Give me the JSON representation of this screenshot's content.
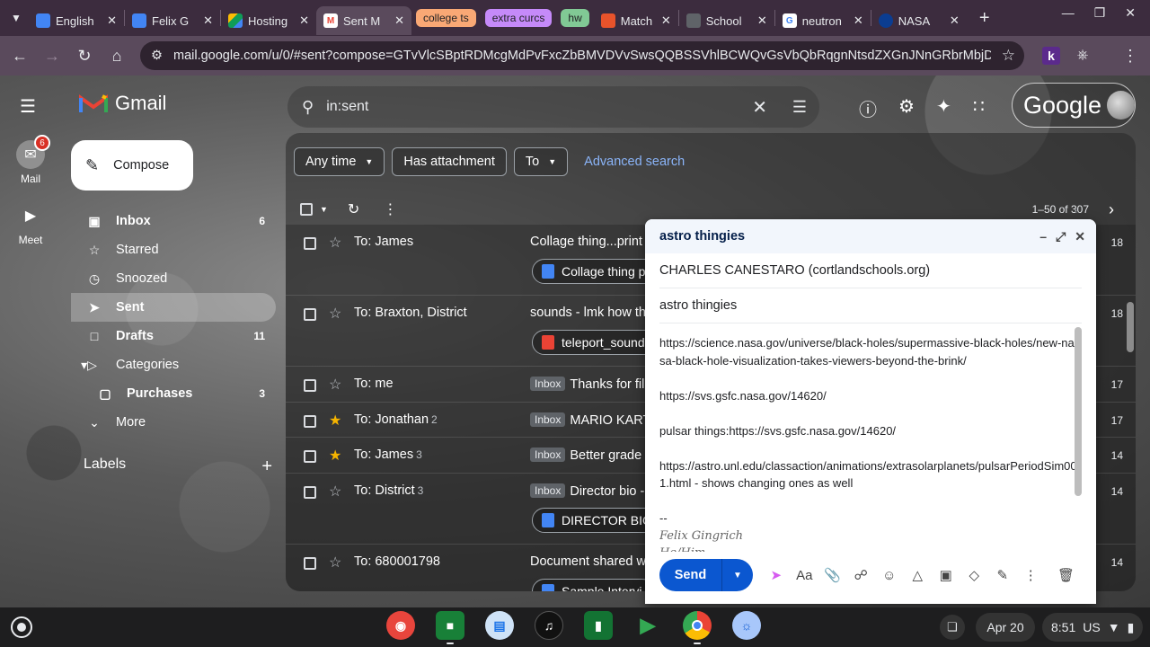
{
  "browser": {
    "tabs": [
      {
        "title": "English",
        "favicon_color": "#4285f4",
        "favicon": "classroom-icon"
      },
      {
        "title": "Felix G",
        "favicon_color": "#4285f4",
        "favicon": "docs-icon"
      },
      {
        "title": "Hosting",
        "favicon_color": "#0f9d58",
        "favicon": "drive-icon"
      },
      {
        "title": "Sent M",
        "favicon_color": "#ea4335",
        "favicon": "gmail-icon",
        "active": true
      }
    ],
    "groups": [
      {
        "label": "college ts",
        "color": "#f9a875"
      },
      {
        "label": "extra curcs",
        "color": "#c58af9"
      },
      {
        "label": "hw",
        "color": "#81c995"
      }
    ],
    "tabs2": [
      {
        "title": "Match",
        "favicon": "flame-icon"
      },
      {
        "title": "School",
        "favicon": "school-icon"
      },
      {
        "title": "neutron",
        "favicon": "google-icon"
      },
      {
        "title": "NASA",
        "favicon": "nasa-icon"
      }
    ],
    "url": "mail.google.com/u/0/#sent?compose=GTvVlcSBptRDMcgMdPvFxcZbBMVDVvSwsQQBSSVhlBCWQvGsVbQbRqgnNtsdZXGnJNnGRbrMbjDGW",
    "profile_letter": "k"
  },
  "gmail": {
    "logo_text": "Gmail",
    "search_query": "in:sent",
    "account_brand": "Google",
    "rail": [
      {
        "label": "Mail",
        "badge": "6"
      },
      {
        "label": "Meet"
      }
    ],
    "compose_label": "Compose",
    "nav": [
      {
        "label": "Inbox",
        "count": "6"
      },
      {
        "label": "Starred",
        "count": ""
      },
      {
        "label": "Snoozed",
        "count": ""
      },
      {
        "label": "Sent",
        "count": ""
      },
      {
        "label": "Drafts",
        "count": "11"
      },
      {
        "label": "Categories",
        "count": ""
      },
      {
        "label": "Purchases",
        "count": "3"
      },
      {
        "label": "More",
        "count": ""
      }
    ],
    "labels_heading": "Labels",
    "filters": {
      "any_time": "Any time",
      "has_attachment": "Has attachment",
      "to": "To",
      "advanced": "Advanced search"
    },
    "pager": "1–50 of 307",
    "rows": [
      {
        "to": "To: James",
        "n": "",
        "starred": false,
        "inbox": false,
        "subject": "Collage thing...print",
        "attachment": "Collage thing p",
        "att_color": "#4285f4",
        "date": "18"
      },
      {
        "to": "To: Braxton, District",
        "n": "",
        "starred": false,
        "inbox": false,
        "subject": "sounds - lmk how th",
        "attachment": "teleport_sound",
        "att_color": "#ea4335",
        "date": "18"
      },
      {
        "to": "To: me",
        "n": "",
        "starred": false,
        "inbox": true,
        "subject": "Thanks for fill",
        "attachment": "",
        "date": "17"
      },
      {
        "to": "To: Jonathan",
        "n": "2",
        "starred": true,
        "inbox": true,
        "subject": "MARIO KART",
        "attachment": "",
        "date": "17"
      },
      {
        "to": "To: James",
        "n": "3",
        "starred": true,
        "inbox": true,
        "subject": "Better grade",
        "attachment": "",
        "date": "14"
      },
      {
        "to": "To: District",
        "n": "3",
        "starred": false,
        "inbox": true,
        "subject": "Director bio -",
        "attachment": "DIRECTOR BIO",
        "att_color": "#4285f4",
        "date": "14"
      },
      {
        "to": "To: 680001798",
        "n": "",
        "starred": false,
        "inbox": false,
        "subject": "Document shared wi",
        "attachment": "Sample Intervi",
        "att_color": "#4285f4",
        "date": "14"
      }
    ],
    "inbox_chip": "Inbox",
    "compose_window": {
      "title": "astro thingies",
      "recipient": "CHARLES CANESTARO (cortlandschools.org)",
      "subject": "astro thingies",
      "body": [
        "https://science.nasa.gov/universe/black-holes/supermassive-black-holes/new-nasa-black-hole-visualization-takes-viewers-beyond-the-brink/",
        "https://svs.gsfc.nasa.gov/14620/",
        "pulsar things:https://svs.gsfc.nasa.gov/14620/",
        "https://astro.unl.edu/classaction/animations/extrasolarplanets/pulsarPeriodSim001.html - shows changing ones as well"
      ],
      "sig_dashes": "--",
      "sig_name": "Felix Gingrich",
      "sig_pronouns": "He/Him",
      "send_label": "Send"
    }
  },
  "shelf": {
    "date": "Apr 20",
    "time": "8:51",
    "locale": "US"
  }
}
